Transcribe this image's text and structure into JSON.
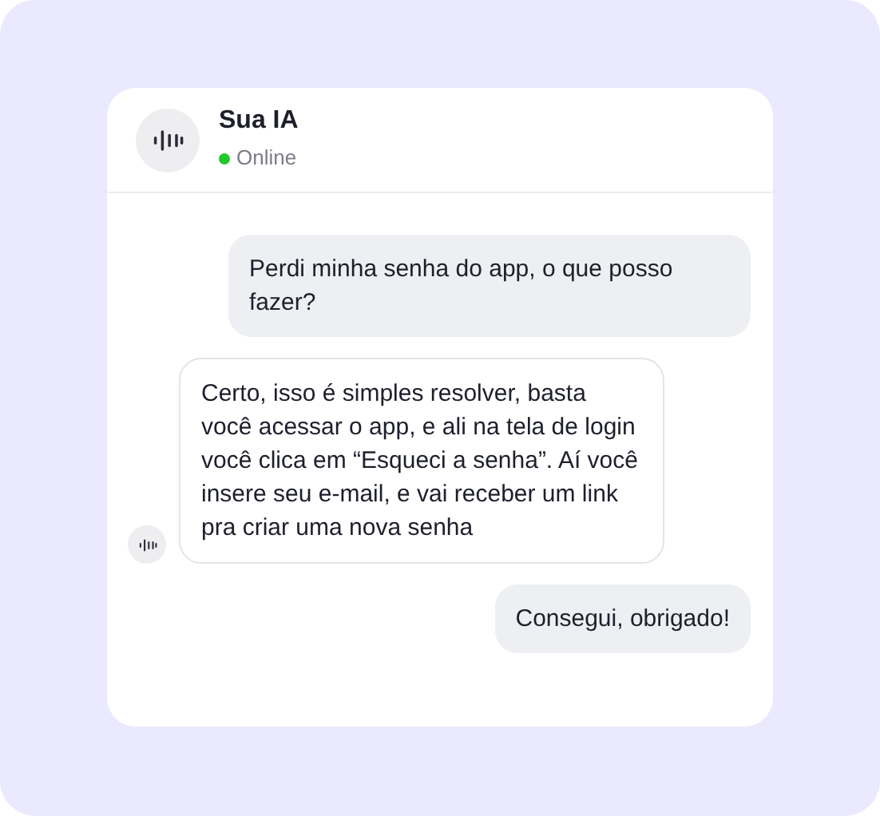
{
  "contact": {
    "name": "Sua IA",
    "status": "Online",
    "online": true
  },
  "messages": [
    {
      "kind": "user",
      "text": "Perdi minha senha do app, o que posso fazer?"
    },
    {
      "kind": "bot",
      "text": "Certo, isso é simples resolver, basta você acessar o app, e ali na tela de login você clica em “Esqueci a senha”. Aí você insere seu e-mail, e vai receber um link pra criar uma nova senha"
    },
    {
      "kind": "user",
      "text": "Consegui, obrigado!"
    }
  ]
}
